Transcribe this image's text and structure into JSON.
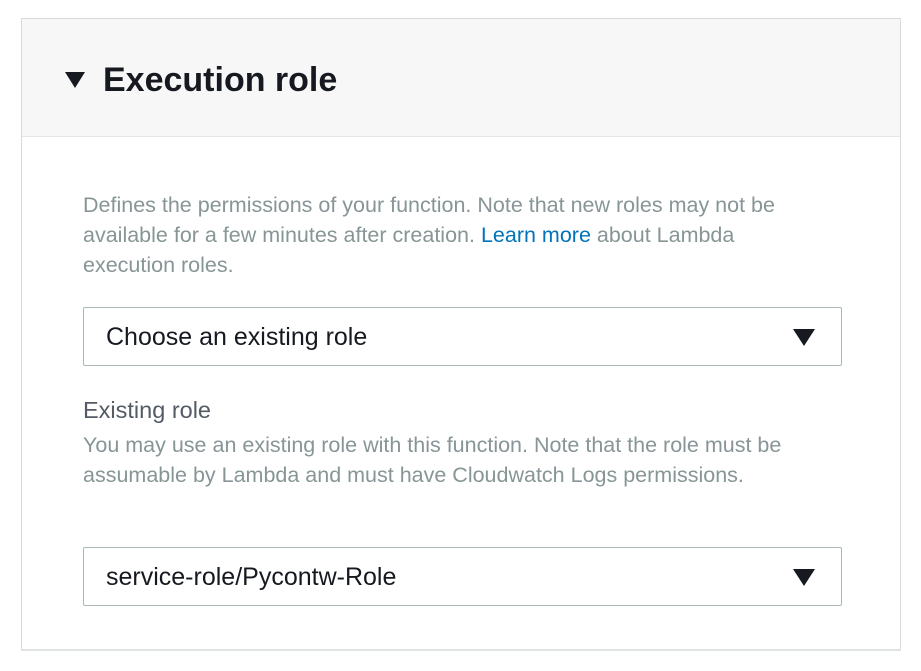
{
  "section": {
    "title": "Execution role",
    "toggle_icon": "caret-down-icon"
  },
  "role_choice": {
    "description_before_link": "Defines the permissions of your function. Note that new roles may not be available for a few minutes after creation. ",
    "link_text": "Learn more",
    "description_after_link": " about Lambda execution roles.",
    "selected": "Choose an existing role",
    "dropdown_icon": "caret-down-icon"
  },
  "existing_role": {
    "label": "Existing role",
    "description": "You may use an existing role with this function. Note that the role must be assumable by Lambda and must have Cloudwatch Logs permissions.",
    "selected": "service-role/Pycontw-Role",
    "dropdown_icon": "caret-down-icon"
  },
  "colors": {
    "link": "#0073bb",
    "muted_text": "#879596",
    "header_bg": "#f7f7f7",
    "border": "#aab7b8"
  }
}
